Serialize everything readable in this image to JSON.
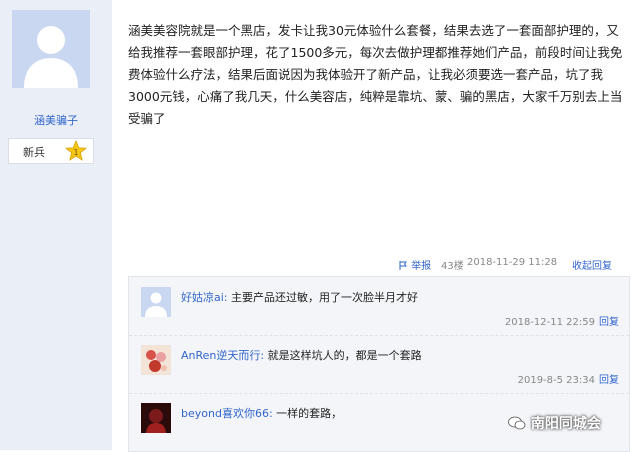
{
  "post": {
    "author": "涵美骗子",
    "rank": "新兵",
    "rank_level": "1",
    "text": "涵美美容院就是一个黑店，发卡让我30元体验什么套餐，结果去选了一套面部护理的，又给我推荐一套眼部护理，花了1500多元，每次去做护理都推荐她们产品，前段时间让我免费体验什么疗法，结果后面说因为我体验开了新产品，让我必须要选一套产品，坑了我3000元钱，心痛了我几天，什么美容店，纯粹是靠坑、蒙、骗的黑店，大家千万别去上当受骗了",
    "report_label": "举报",
    "floor": "43楼",
    "timestamp": "2018-11-29 11:28",
    "reply_label": "收起回复"
  },
  "comments": [
    {
      "user": "好姑凉ai:",
      "text": " 主要产品还过敏，用了一次脸半月才好",
      "time": "2018-12-11 22:59",
      "reply": "回复"
    },
    {
      "user": "AnRen逆天而行:",
      "text": " 就是这样坑人的，都是一个套路",
      "time": "2019-8-5 23:34",
      "reply": "回复"
    },
    {
      "user": "beyond喜欢你66:",
      "text": " 一样的套路，",
      "time": "",
      "reply": ""
    }
  ],
  "watermark": "南阳同城会",
  "colors": {
    "link": "#3366cc",
    "sidebar_bg": "#e9eef7",
    "comment_bg": "#f3f5f8",
    "star": "#f5c518"
  }
}
